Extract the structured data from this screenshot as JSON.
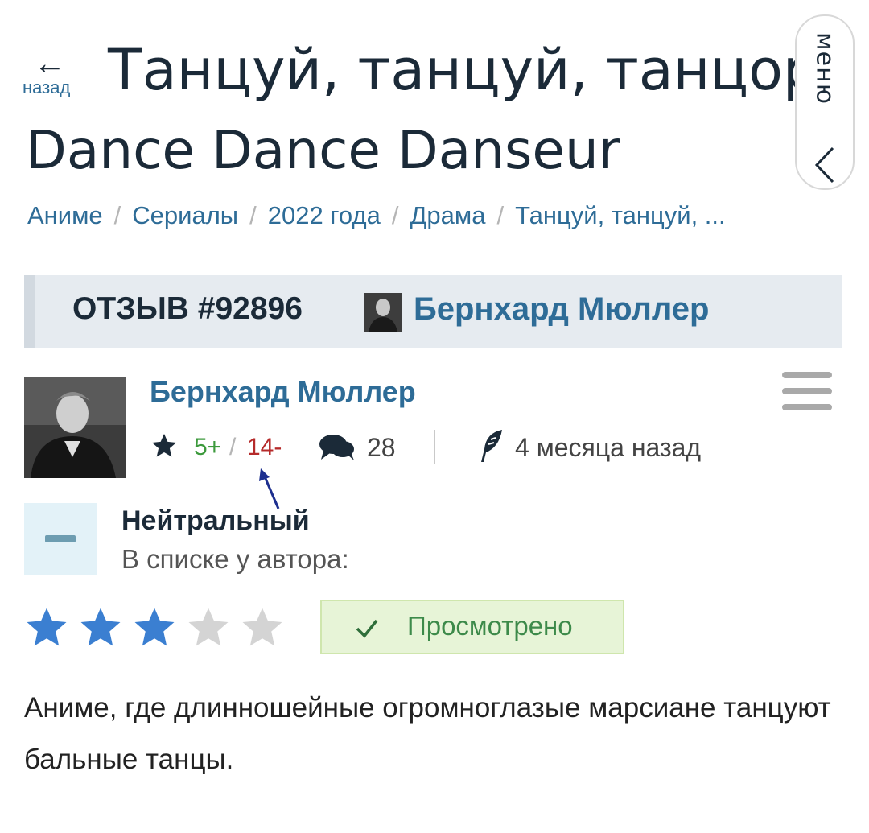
{
  "header": {
    "back_label": "назад",
    "title_ru": "Танцуй, танцуй, танцор",
    "title_en": "Dance Dance Danseur",
    "menu_label": "меню"
  },
  "breadcrumbs": [
    "Аниме",
    "Сериалы",
    "2022 года",
    "Драма",
    "Танцуй, танцуй, ..."
  ],
  "review": {
    "number_label": "ОТЗЫВ #92896",
    "author": "Бернхард Мюллер",
    "votes_plus": "5+",
    "votes_sep": "/",
    "votes_minus": "14-",
    "comments": "28",
    "posted": "4 месяца назад",
    "verdict": "Нейтральный",
    "in_list_label": "В списке у автора:",
    "rating": 3,
    "rating_max": 5,
    "status": "Просмотрено",
    "text": "Аниме, где длинношейные огромноглазые марсиане танцуют бальные танцы."
  },
  "colors": {
    "link": "#2e6c97",
    "star_on": "#3b7fd1",
    "star_off": "#d4d4d4",
    "plus": "#3d9a3d",
    "minus": "#b52a2a",
    "watched_bg": "#e7f4d7"
  },
  "icons": [
    "back-arrow-icon",
    "chevron-left-icon",
    "star-icon",
    "comments-icon",
    "feather-icon",
    "hamburger-icon",
    "check-icon",
    "minus-icon"
  ]
}
